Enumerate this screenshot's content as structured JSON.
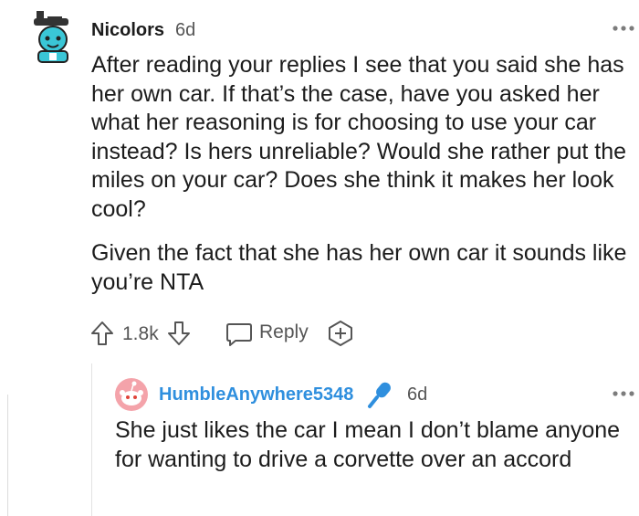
{
  "comment": {
    "username": "Nicolors",
    "age": "6d",
    "paragraphs": [
      "After reading your replies I see that you said she has her own car. If that’s the case, have you asked her what her reasoning is for choosing to use your car instead? Is hers unreliable? Would she rather put the miles on your car? Does she think it makes her look cool?",
      "Given the fact that she has her own car it sounds like you’re NTA"
    ],
    "votes": "1.8k",
    "reply_label": "Reply",
    "icons": {
      "avatar": "avatar-icon",
      "more": "more-icon",
      "upvote": "upvote-icon",
      "downvote": "downvote-icon",
      "reply": "reply-icon",
      "award": "award-icon"
    }
  },
  "reply": {
    "username": "HumbleAnywhere5348",
    "age": "6d",
    "text": "She just likes the car I mean I don’t blame anyone for wanting to drive a corvette over an accord",
    "icons": {
      "avatar": "snoo-avatar-icon",
      "flair": "microphone-icon",
      "more": "more-icon"
    }
  },
  "colors": {
    "username_primary": "#1c1c1c",
    "username_op": "#2f8fde",
    "mic_blue": "#2f8fde",
    "avatar_teal": "#3ac6d6",
    "snoo_bg": "#f4a3aa"
  }
}
